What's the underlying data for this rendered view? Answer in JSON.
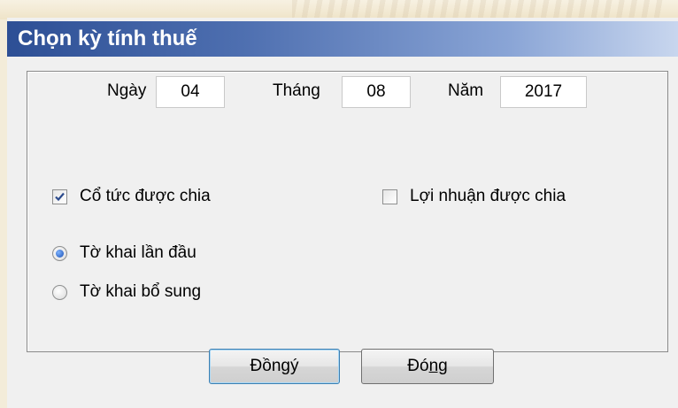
{
  "dialog": {
    "title": "Chọn kỳ tính thuế",
    "date": {
      "day_label": "Ngày",
      "day_value": "04",
      "month_label": "Tháng",
      "month_value": "08",
      "year_label": "Năm",
      "year_value": "2017"
    },
    "checkboxes": [
      {
        "label": "Cổ tức được chia",
        "checked": true
      },
      {
        "label": "Lợi nhuận được chia",
        "checked": false
      }
    ],
    "radios": [
      {
        "label": "Tờ khai lần đầu",
        "selected": true
      },
      {
        "label": "Tờ khai bổ sung",
        "selected": false
      }
    ],
    "buttons": {
      "ok_label_prefix": "Đồn",
      "ok_label_mnemonic": "g",
      "ok_label_suffix": " ý",
      "close_label_prefix": "Đó",
      "close_label_mnemonic": "ng",
      "close_label_suffix": ""
    }
  },
  "colors": {
    "title_start": "#2d4f95",
    "title_end": "#c8d6ee",
    "default_button_border": "#3c7fb1",
    "radio_dot": "#1a4fb3"
  }
}
